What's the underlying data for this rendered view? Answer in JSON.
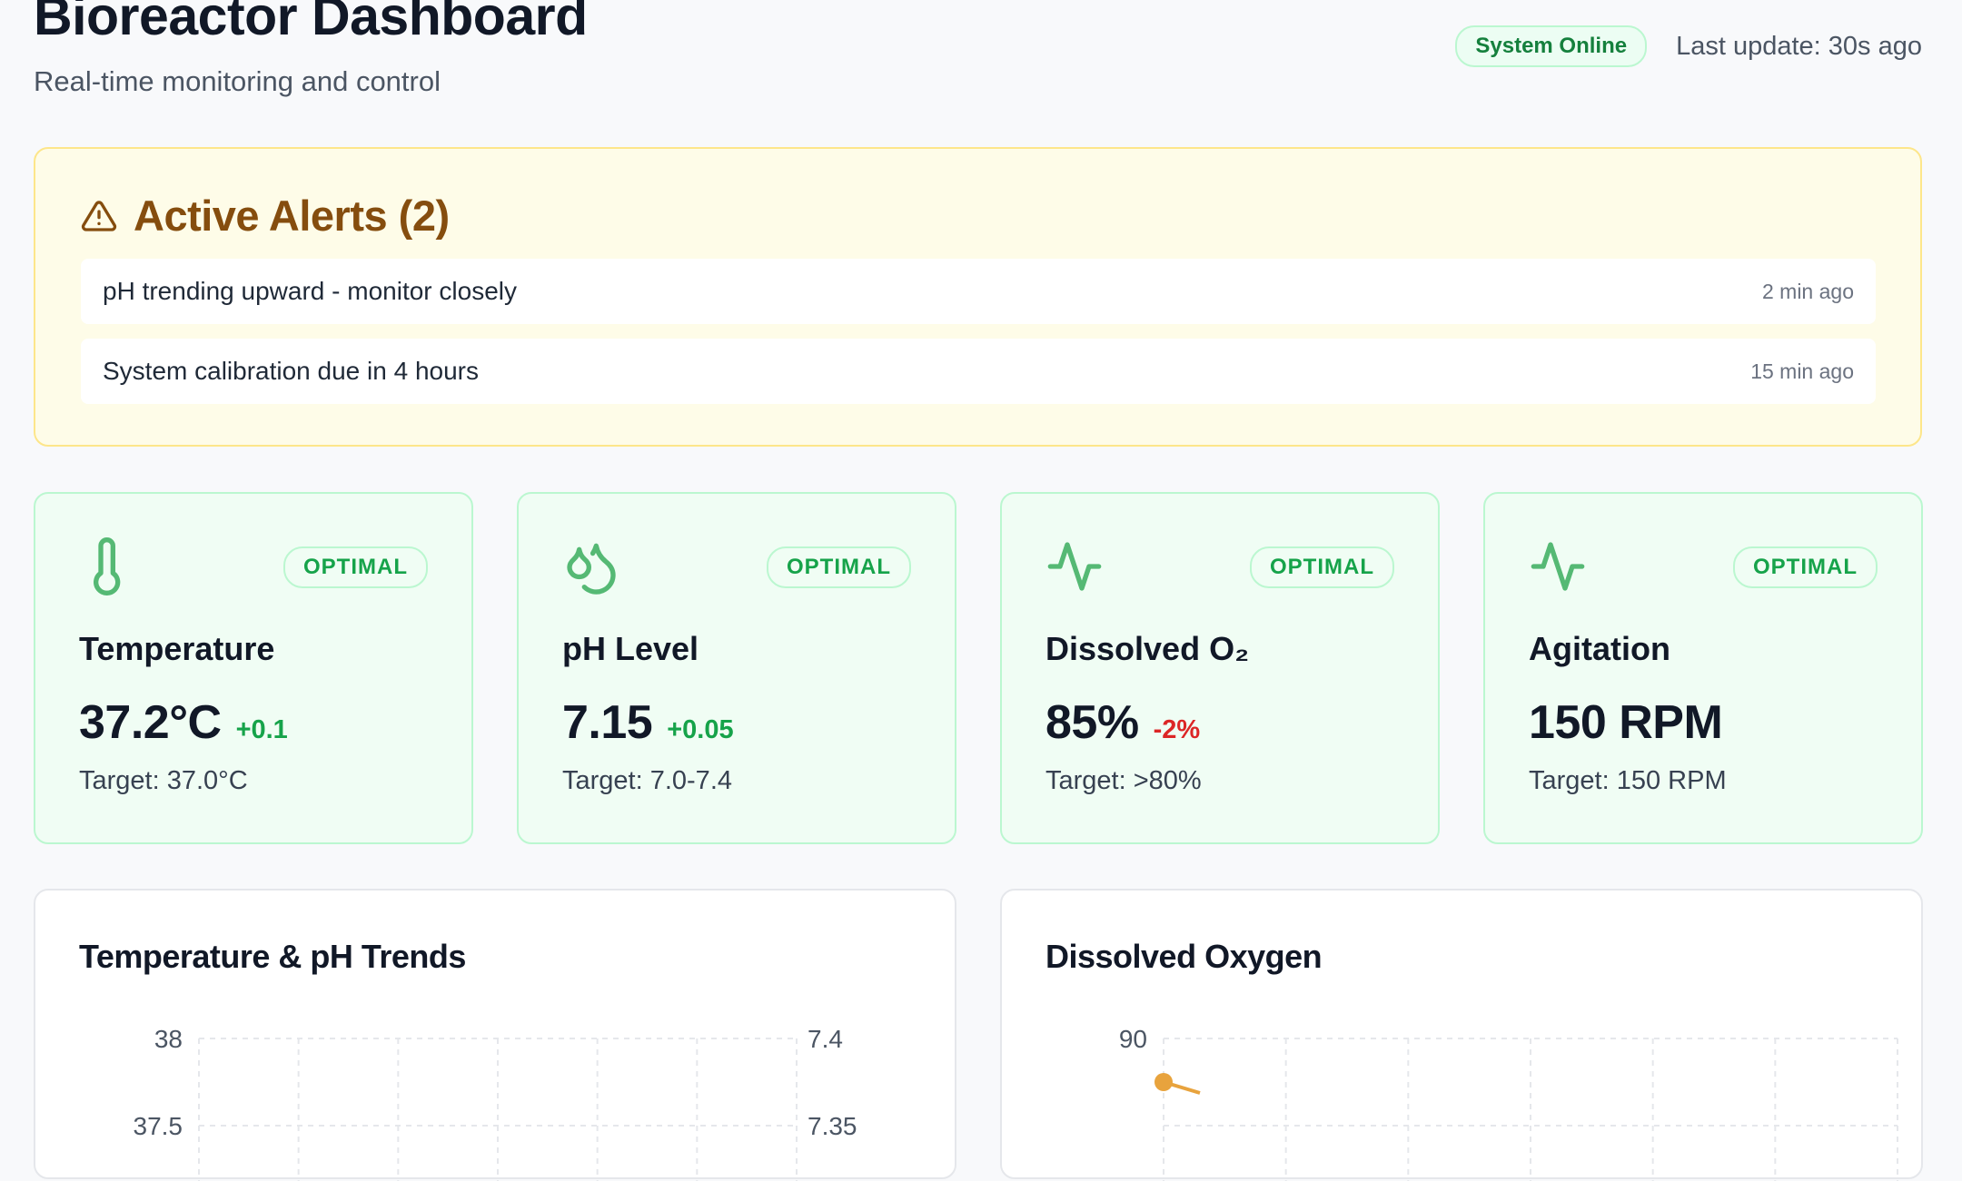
{
  "header": {
    "title": "Bioreactor Dashboard",
    "subtitle": "Real-time monitoring and control",
    "status_badge": "System Online",
    "last_update": "Last update: 30s ago"
  },
  "alerts": {
    "title": "Active Alerts (2)",
    "icon": "alert-triangle-icon",
    "items": [
      {
        "text": "pH trending upward - monitor closely",
        "time": "2 min ago"
      },
      {
        "text": "System calibration due in 4 hours",
        "time": "15 min ago"
      }
    ]
  },
  "metrics": [
    {
      "icon": "thermometer-icon",
      "status": "OPTIMAL",
      "label": "Temperature",
      "value": "37.2°C",
      "delta": "+0.1",
      "delta_direction": "up",
      "target": "Target: 37.0°C"
    },
    {
      "icon": "droplets-icon",
      "status": "OPTIMAL",
      "label": "pH Level",
      "value": "7.15",
      "delta": "+0.05",
      "delta_direction": "up",
      "target": "Target: 7.0-7.4"
    },
    {
      "icon": "activity-icon",
      "status": "OPTIMAL",
      "label": "Dissolved O₂",
      "value": "85%",
      "delta": "-2%",
      "delta_direction": "down",
      "target": "Target: >80%"
    },
    {
      "icon": "activity-icon",
      "status": "OPTIMAL",
      "label": "Agitation",
      "value": "150 RPM",
      "delta": "",
      "delta_direction": "none",
      "target": "Target: 150 RPM"
    }
  ],
  "colors": {
    "optimal_green": "#16a34a",
    "alert_amber": "#854d0e",
    "negative_red": "#dc2626",
    "oxygen_series": "#e8a33d"
  },
  "charts": {
    "temp_ph": {
      "title": "Temperature & pH Trends"
    },
    "oxygen": {
      "title": "Dissolved Oxygen"
    }
  },
  "chart_data": [
    {
      "type": "line",
      "title": "Temperature & pH Trends",
      "xlabel": "",
      "ylabel": "",
      "y_left_ticks": [
        "38",
        "37.5"
      ],
      "y_right_ticks": [
        "7.4",
        "7.35"
      ],
      "ylim_left": [
        37.5,
        38
      ],
      "ylim_right": [
        7.35,
        7.4
      ],
      "grid": true,
      "series": []
    },
    {
      "type": "line",
      "title": "Dissolved Oxygen",
      "xlabel": "",
      "ylabel": "",
      "y_ticks": [
        "90"
      ],
      "grid": true,
      "series": [
        {
          "color": "#e8a33d",
          "values": [
            88
          ]
        }
      ]
    }
  ]
}
